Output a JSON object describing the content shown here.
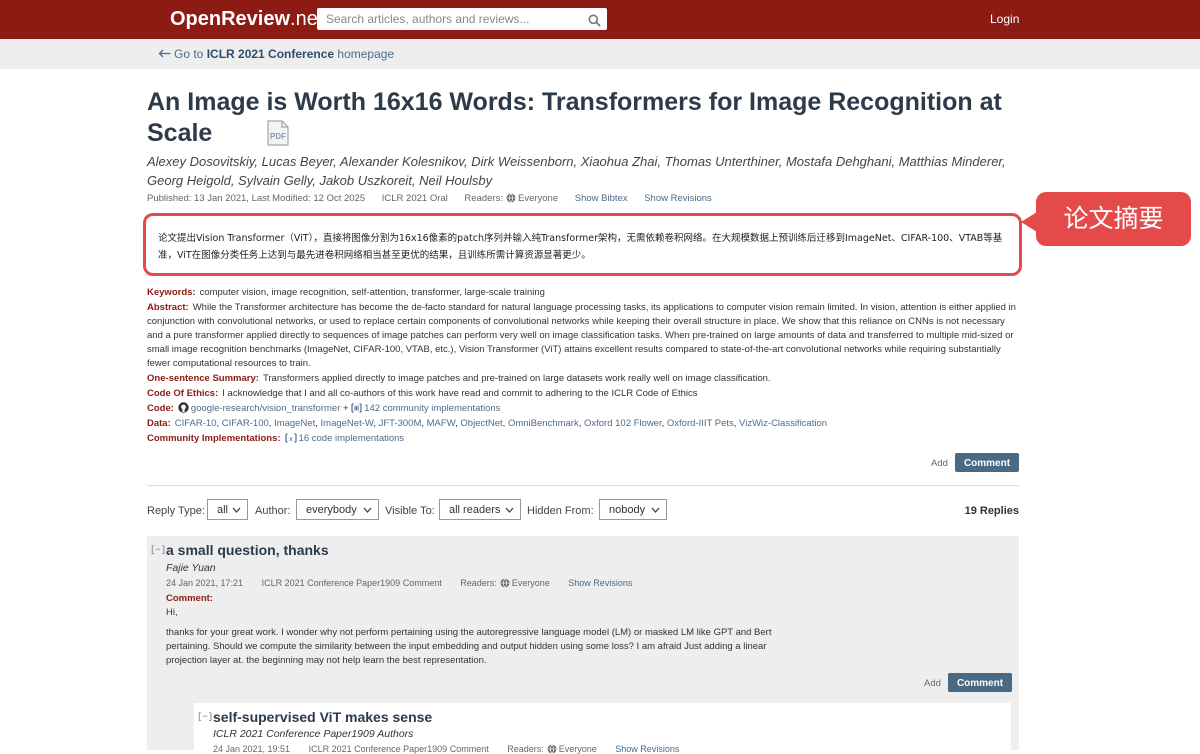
{
  "header": {
    "brand_main": "OpenReview",
    "brand_suffix": ".net",
    "search_placeholder": "Search articles, authors and reviews...",
    "login": "Login"
  },
  "subheader": {
    "back_prefix": "Go to ",
    "back_venue": "ICLR 2021 Conference",
    "back_suffix": " homepage"
  },
  "paper": {
    "title": "An Image is Worth 16x16 Words: Transformers for Image Recognition at Scale",
    "pdf_label": "PDF",
    "authors": "Alexey Dosovitskiy, Lucas Beyer, Alexander Kolesnikov, Dirk Weissenborn, Xiaohua Zhai, Thomas Unterthiner, Mostafa Dehghani, Matthias Minderer, Georg Heigold, Sylvain Gelly, Jakob Uszkoreit, Neil Houlsby",
    "published": "Published: 13 Jan 2021, Last Modified: 12 Oct 2025",
    "venue": "ICLR 2021 Oral",
    "readers_label": "Readers:",
    "readers": "Everyone",
    "show_bibtex": "Show Bibtex",
    "show_revisions": "Show Revisions"
  },
  "annotation": {
    "summary_zh": "论文提出Vision Transformer（ViT），直接将图像分割为16x16像素的patch序列并输入纯Transformer架构，无需依赖卷积网络。在大规模数据上预训练后迁移到ImageNet、CIFAR-100、VTAB等基准，ViT在图像分类任务上达到与最先进卷积网络相当甚至更优的结果，且训练所需计算资源显著更少。",
    "callout": "论文摘要",
    "color": "#e54a4a"
  },
  "fields": {
    "keywords_label": "Keywords:",
    "keywords": "computer vision, image recognition, self-attention, transformer, large-scale training",
    "abstract_label": "Abstract:",
    "abstract": "While the Transformer architecture has become the de-facto standard for natural language processing tasks, its applications to computer vision remain limited. In vision, attention is either applied in conjunction with convolutional networks, or used to replace certain components of convolutional networks while keeping their overall structure in place. We show that this reliance on CNNs is not necessary and a pure transformer applied directly to sequences of image patches can perform very well on image classification tasks. When pre-trained on large amounts of data and transferred to multiple mid-sized or small image recognition benchmarks (ImageNet, CIFAR-100, VTAB, etc.), Vision Transformer (ViT) attains excellent results compared to state-of-the-art convolutional networks while requiring substantially fewer computational resources to train.",
    "summary_label": "One-sentence Summary:",
    "summary": "Transformers applied directly to image patches and pre-trained on large datasets work really well on image classification.",
    "ethics_label": "Code Of Ethics:",
    "ethics": "I acknowledge that I and all co-authors of this work have read and commit to adhering to the ICLR Code of Ethics",
    "code_label": "Code:",
    "code_repo": "google-research/vision_transformer",
    "code_plus": "+",
    "code_community": "142 community implementations",
    "data_label": "Data:",
    "data": [
      "CIFAR-10",
      "CIFAR-100",
      "ImageNet",
      "ImageNet-W",
      "JFT-300M",
      "MAFW",
      "ObjectNet",
      "OmniBenchmark",
      "Oxford 102 Flower",
      "Oxford-IIIT Pets",
      "VizWiz-Classification"
    ],
    "community_label": "Community Implementations:",
    "community": "16 code implementations"
  },
  "actions": {
    "add": "Add",
    "comment": "Comment"
  },
  "filters": {
    "reply_type_label": "Reply Type:",
    "reply_type": "all",
    "author_label": "Author:",
    "author": "everybody",
    "visible_label": "Visible To:",
    "visible": "all readers",
    "hidden_label": "Hidden From:",
    "hidden": "nobody",
    "replies": "19 Replies"
  },
  "note": {
    "collapse": "[−]",
    "title": "a small question, thanks",
    "author": "Fajie Yuan",
    "date": "24 Jan 2021, 17:21",
    "invitation": "ICLR 2021 Conference Paper1909 Comment",
    "readers_label": "Readers:",
    "readers": "Everyone",
    "show_revisions": "Show Revisions",
    "comment_label": "Comment:",
    "greeting": "Hi,",
    "body": "thanks for your great work. I wonder why not perform pertaining using the autoregressive language model (LM) or masked LM like GPT and Bert pertaining. Should we compute the similarity between the input embedding and output hidden using some loss? I am afraid Just adding a linear projection layer at. the beginning may not help learn the best representation."
  },
  "reply": {
    "collapse": "[−]",
    "title": "self-supervised ViT makes sense",
    "author": "ICLR 2021 Conference Paper1909 Authors",
    "date": "24 Jan 2021, 19:51",
    "invitation": "ICLR 2021 Conference Paper1909 Comment",
    "readers_label": "Readers:",
    "readers": "Everyone",
    "show_revisions": "Show Revisions"
  }
}
